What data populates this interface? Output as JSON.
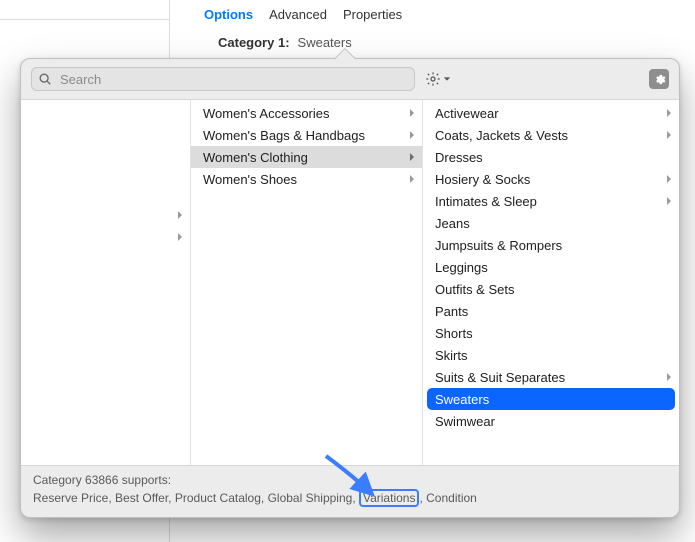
{
  "background": {
    "tabs": [
      {
        "label": "Options",
        "active": true
      },
      {
        "label": "Advanced",
        "active": false
      },
      {
        "label": "Properties",
        "active": false
      }
    ],
    "category_label": "Category 1:",
    "category_value": "Sweaters"
  },
  "search": {
    "placeholder": "Search"
  },
  "columns": {
    "col1": {
      "blank_rows": 4,
      "last_row_has_chevron": true
    },
    "col2": [
      {
        "label": "Women's Accessories",
        "has_children": true,
        "selected": false
      },
      {
        "label": "Women's Bags & Handbags",
        "has_children": true,
        "selected": false
      },
      {
        "label": "Women's Clothing",
        "has_children": true,
        "selected": true
      },
      {
        "label": "Women's Shoes",
        "has_children": true,
        "selected": false
      }
    ],
    "col3": [
      {
        "label": "Activewear",
        "has_children": true,
        "selected": false
      },
      {
        "label": "Coats, Jackets & Vests",
        "has_children": true,
        "selected": false
      },
      {
        "label": "Dresses",
        "has_children": false,
        "selected": false
      },
      {
        "label": "Hosiery & Socks",
        "has_children": true,
        "selected": false
      },
      {
        "label": "Intimates & Sleep",
        "has_children": true,
        "selected": false
      },
      {
        "label": "Jeans",
        "has_children": false,
        "selected": false
      },
      {
        "label": "Jumpsuits & Rompers",
        "has_children": false,
        "selected": false
      },
      {
        "label": "Leggings",
        "has_children": false,
        "selected": false
      },
      {
        "label": "Outfits & Sets",
        "has_children": false,
        "selected": false
      },
      {
        "label": "Pants",
        "has_children": false,
        "selected": false
      },
      {
        "label": "Shorts",
        "has_children": false,
        "selected": false
      },
      {
        "label": "Skirts",
        "has_children": false,
        "selected": false
      },
      {
        "label": "Suits & Suit Separates",
        "has_children": true,
        "selected": false
      },
      {
        "label": "Sweaters",
        "has_children": false,
        "selected": true
      },
      {
        "label": "Swimwear",
        "has_children": false,
        "selected": false
      }
    ]
  },
  "footer": {
    "line1": "Category 63866 supports:",
    "features": [
      "Reserve Price",
      "Best Offer",
      "Product Catalog",
      "Global Shipping",
      "Variations",
      "Condition"
    ],
    "highlight": "Variations"
  }
}
